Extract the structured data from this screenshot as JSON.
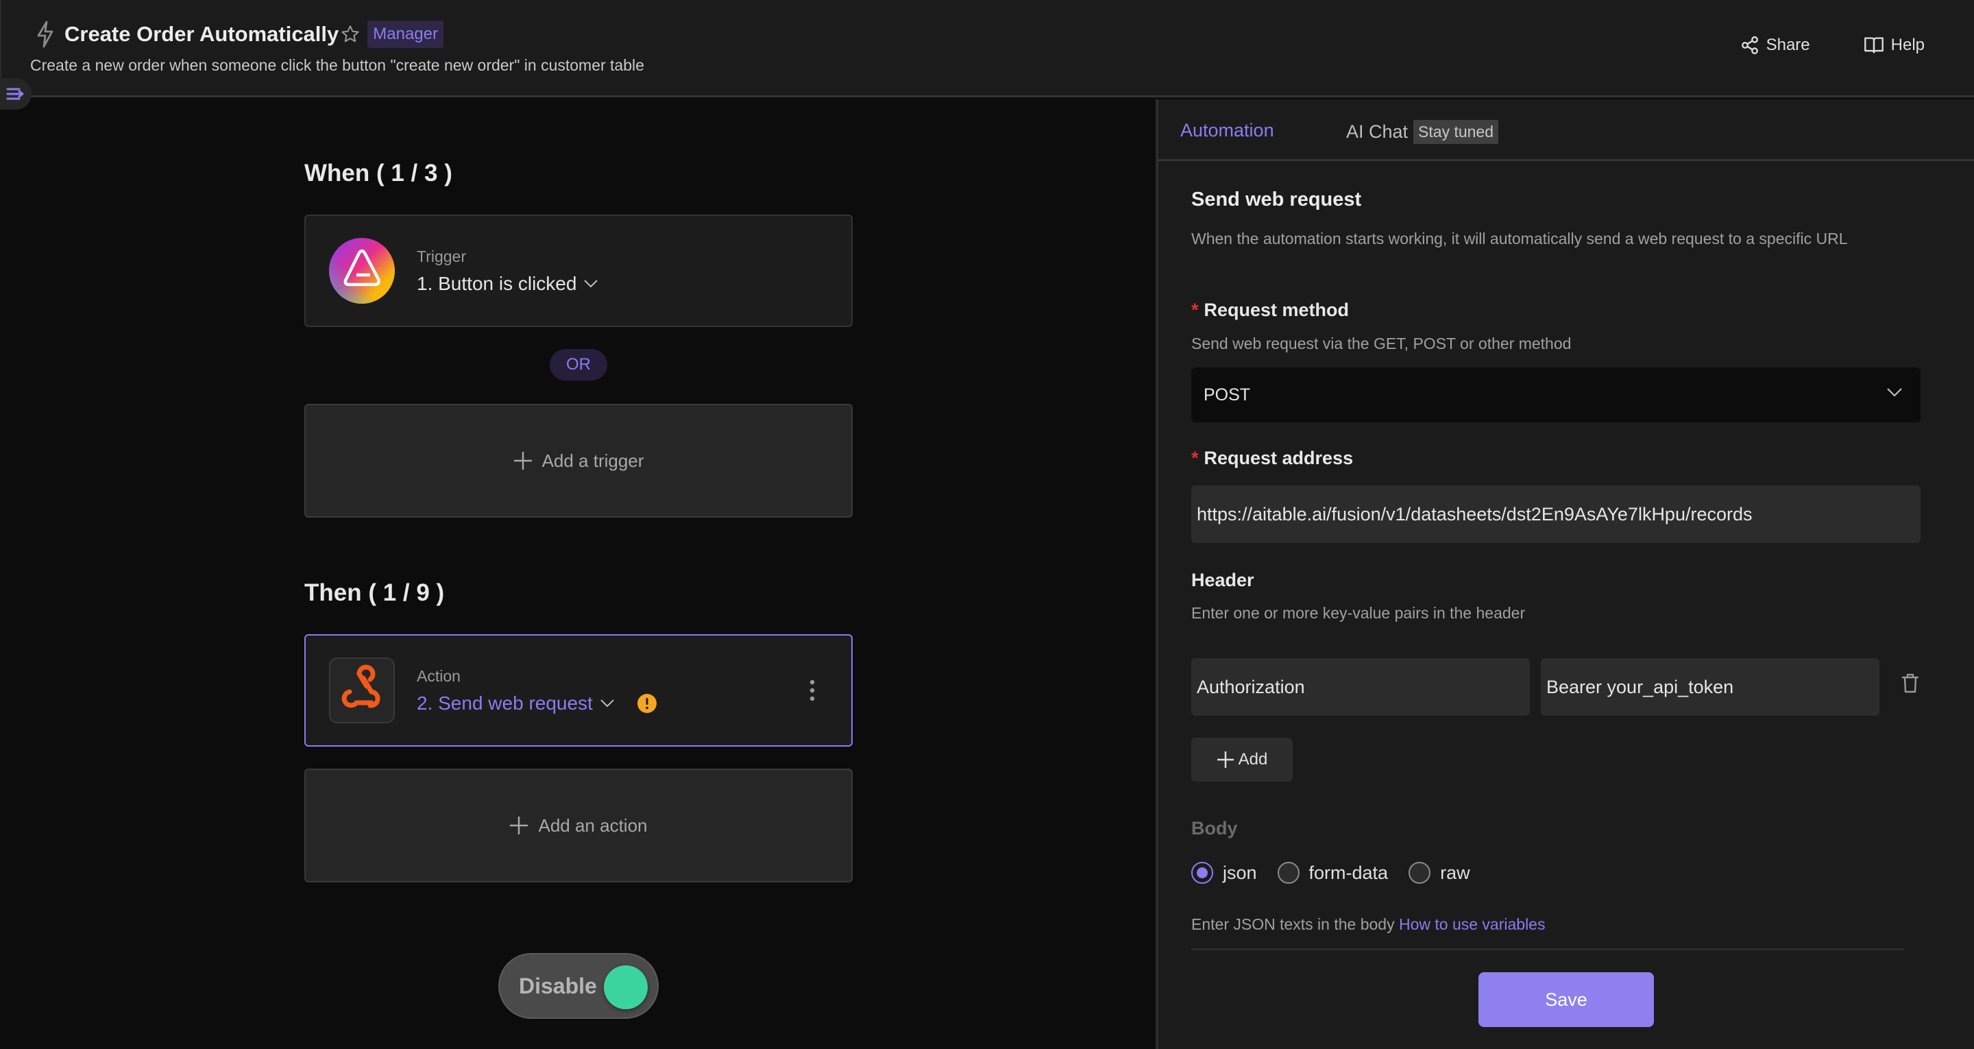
{
  "header": {
    "title": "Create Order Automatically",
    "role_badge": "Manager",
    "subtitle": "Create a new order when someone click the button \"create new order\" in customer table",
    "actions": [
      {
        "label": "Share",
        "icon": "share-icon"
      },
      {
        "label": "Help",
        "icon": "book-icon"
      }
    ]
  },
  "canvas": {
    "when_heading": "When ( 1 / 3 )",
    "trigger": {
      "type": "Trigger",
      "name": "1. Button is clicked",
      "icon": "button-trigger-logo"
    },
    "or_label": "OR",
    "add_trigger_label": "Add a trigger",
    "then_heading": "Then ( 1 / 9 )",
    "action": {
      "type": "Action",
      "name": "2. Send web request",
      "icon": "webhook-icon",
      "warning": true
    },
    "add_action_label": "Add an action",
    "toggle": {
      "label": "Disable",
      "on": true
    }
  },
  "panel": {
    "tabs": [
      {
        "label": "Automation",
        "active": true
      },
      {
        "label": "AI Chat",
        "badge": "Stay tuned",
        "active": false
      }
    ],
    "title": "Send web request",
    "description": "When the automation starts working, it will automatically send a web request to a specific URL",
    "request_method": {
      "label": "Request method",
      "required": "*",
      "hint": "Send web request via the GET, POST or other method",
      "value": "POST"
    },
    "request_address": {
      "label": "Request address",
      "required": "*",
      "value": "https://aitable.ai/fusion/v1/datasheets/dst2En9AsAYe7lkHpu/records"
    },
    "header_section": {
      "label": "Header",
      "hint": "Enter one or more key-value pairs in the header",
      "pairs": [
        {
          "key": "Authorization",
          "value": "Bearer your_api_token"
        }
      ],
      "add_label": "Add"
    },
    "body": {
      "label": "Body",
      "options": [
        {
          "label": "json",
          "checked": true
        },
        {
          "label": "form-data",
          "checked": false
        },
        {
          "label": "raw",
          "checked": false
        }
      ],
      "hint": "Enter JSON texts in the body",
      "link": "How to use variables"
    },
    "save_label": "Save"
  },
  "colors": {
    "accent": "#8b7cf0",
    "toggle_on": "#3cd49e",
    "required": "#e0302e",
    "warning": "#f5a623",
    "webhook": "#f25a1a"
  }
}
